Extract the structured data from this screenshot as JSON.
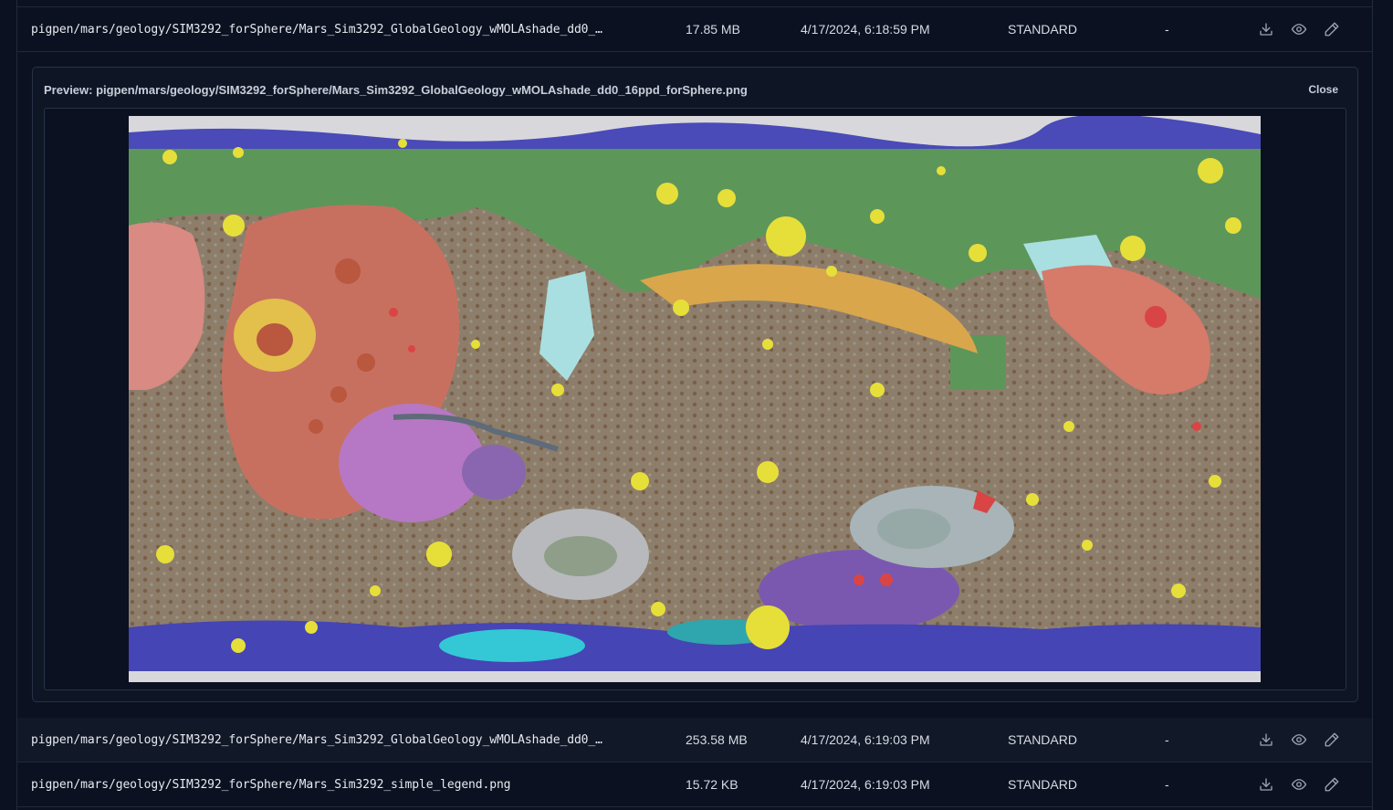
{
  "rows": [
    {
      "path": "pigpen/mars/geology/SIM3292_forSphere/Mars_Sim3292_GlobalGeology_wMOLAshade_dd0_…",
      "size": "17.85 MB",
      "date": "4/17/2024, 6:18:59 PM",
      "storage_class": "STANDARD",
      "extra": "-"
    },
    {
      "path": "pigpen/mars/geology/SIM3292_forSphere/Mars_Sim3292_GlobalGeology_wMOLAshade_dd0_…",
      "size": "253.58 MB",
      "date": "4/17/2024, 6:19:03 PM",
      "storage_class": "STANDARD",
      "extra": "-"
    },
    {
      "path": "pigpen/mars/geology/SIM3292_forSphere/Mars_Sim3292_simple_legend.png",
      "size": "15.72 KB",
      "date": "4/17/2024, 6:19:03 PM",
      "storage_class": "STANDARD",
      "extra": "-"
    }
  ],
  "preview": {
    "title": "Preview: pigpen/mars/geology/SIM3292_forSphere/Mars_Sim3292_GlobalGeology_wMOLAshade_dd0_16ppd_forSphere.png",
    "close_label": "Close"
  },
  "icons": {
    "download": "download-icon",
    "view": "eye-icon",
    "edit": "pencil-icon"
  },
  "colors": {
    "background": "#0b1120",
    "row_alt": "#111827",
    "border": "#1f2a3d",
    "icon": "#9ca3af"
  }
}
